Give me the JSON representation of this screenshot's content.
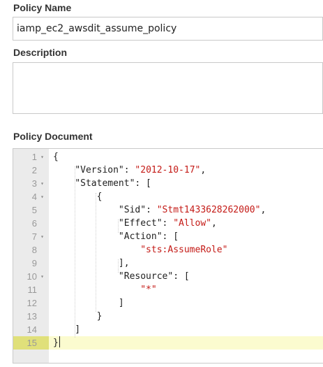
{
  "policy_name": {
    "label": "Policy Name",
    "value": "iamp_ec2_awsdit_assume_policy"
  },
  "description": {
    "label": "Description",
    "value": ""
  },
  "policy_document": {
    "label": "Policy Document",
    "lines": [
      {
        "num": "1",
        "fold": true,
        "segments": [
          {
            "t": "{",
            "c": "p"
          }
        ]
      },
      {
        "num": "2",
        "fold": false,
        "segments": [
          {
            "t": "    ",
            "c": "p"
          },
          {
            "t": "\"Version\"",
            "c": "key"
          },
          {
            "t": ": ",
            "c": "p"
          },
          {
            "t": "\"2012-10-17\"",
            "c": "str"
          },
          {
            "t": ",",
            "c": "p"
          }
        ]
      },
      {
        "num": "3",
        "fold": true,
        "segments": [
          {
            "t": "    ",
            "c": "p"
          },
          {
            "t": "\"Statement\"",
            "c": "key"
          },
          {
            "t": ": [",
            "c": "p"
          }
        ]
      },
      {
        "num": "4",
        "fold": true,
        "segments": [
          {
            "t": "        {",
            "c": "p"
          }
        ]
      },
      {
        "num": "5",
        "fold": false,
        "segments": [
          {
            "t": "            ",
            "c": "p"
          },
          {
            "t": "\"Sid\"",
            "c": "key"
          },
          {
            "t": ": ",
            "c": "p"
          },
          {
            "t": "\"Stmt1433628262000\"",
            "c": "str"
          },
          {
            "t": ",",
            "c": "p"
          }
        ]
      },
      {
        "num": "6",
        "fold": false,
        "segments": [
          {
            "t": "            ",
            "c": "p"
          },
          {
            "t": "\"Effect\"",
            "c": "key"
          },
          {
            "t": ": ",
            "c": "p"
          },
          {
            "t": "\"Allow\"",
            "c": "str"
          },
          {
            "t": ",",
            "c": "p"
          }
        ]
      },
      {
        "num": "7",
        "fold": true,
        "segments": [
          {
            "t": "            ",
            "c": "p"
          },
          {
            "t": "\"Action\"",
            "c": "key"
          },
          {
            "t": ": [",
            "c": "p"
          }
        ]
      },
      {
        "num": "8",
        "fold": false,
        "segments": [
          {
            "t": "                ",
            "c": "p"
          },
          {
            "t": "\"sts:AssumeRole\"",
            "c": "str"
          }
        ]
      },
      {
        "num": "9",
        "fold": false,
        "segments": [
          {
            "t": "            ],",
            "c": "p"
          }
        ]
      },
      {
        "num": "10",
        "fold": true,
        "segments": [
          {
            "t": "            ",
            "c": "p"
          },
          {
            "t": "\"Resource\"",
            "c": "key"
          },
          {
            "t": ": [",
            "c": "p"
          }
        ]
      },
      {
        "num": "11",
        "fold": false,
        "segments": [
          {
            "t": "                ",
            "c": "p"
          },
          {
            "t": "\"*\"",
            "c": "str"
          }
        ]
      },
      {
        "num": "12",
        "fold": false,
        "segments": [
          {
            "t": "            ]",
            "c": "p"
          }
        ]
      },
      {
        "num": "13",
        "fold": false,
        "segments": [
          {
            "t": "        }",
            "c": "p"
          }
        ]
      },
      {
        "num": "14",
        "fold": false,
        "segments": [
          {
            "t": "    ]",
            "c": "p"
          }
        ]
      },
      {
        "num": "15",
        "fold": false,
        "segments": [
          {
            "t": "}",
            "c": "p"
          }
        ]
      }
    ],
    "active_line": "15",
    "colors": {
      "string": "#c41a16",
      "active_line_bg": "#fbfbcf",
      "active_gutter_bg": "#e0e07a",
      "gutter_bg": "#ebebeb"
    }
  }
}
